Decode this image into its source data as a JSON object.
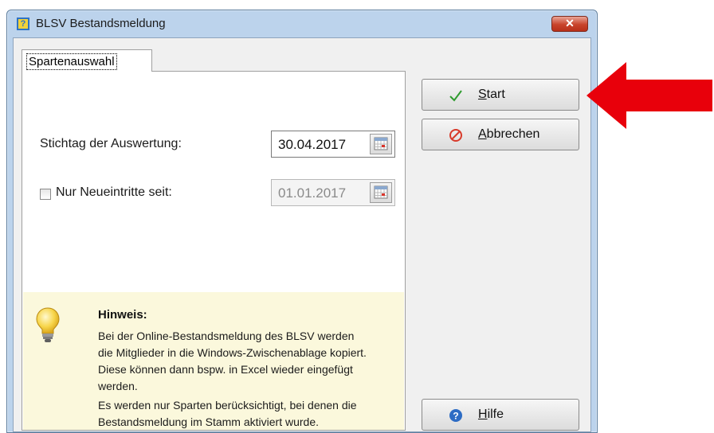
{
  "window": {
    "title": "BLSV Bestandsmeldung",
    "close_glyph": "✕"
  },
  "tabs": [
    {
      "label": "Spartenauswahl"
    }
  ],
  "form": {
    "stichtag_label": "Stichtag der Auswertung:",
    "stichtag_value": "30.04.2017",
    "neueintritte_label": "Nur Neueintritte seit:",
    "neueintritte_value": "01.01.2017",
    "neueintritte_checked": false
  },
  "hint": {
    "title": "Hinweis:",
    "lines": [
      "Bei der Online-Bestandsmeldung des BLSV werden",
      "die Mitglieder in die Windows-Zwischenablage kopiert.",
      "Diese können dann bspw. in Excel wieder eingefügt",
      "werden.",
      "Es werden nur Sparten berücksichtigt, bei denen die",
      "Bestandsmeldung im Stamm aktiviert wurde."
    ]
  },
  "buttons": {
    "start": "Start",
    "cancel": "Abbrechen",
    "help": "Hilfe"
  },
  "icons": {
    "app": "app-icon",
    "calendar": "calendar-icon",
    "start": "checkmark-icon",
    "cancel": "cancel-icon",
    "help": "help-icon",
    "hint": "lightbulb-icon",
    "annotation": "red-arrow"
  },
  "colors": {
    "arrow": "#e8000b",
    "hint_bg": "#fbf8dc",
    "check": "#2e9b2e",
    "cancel": "#d83a2a",
    "help": "#2d6cc4"
  }
}
